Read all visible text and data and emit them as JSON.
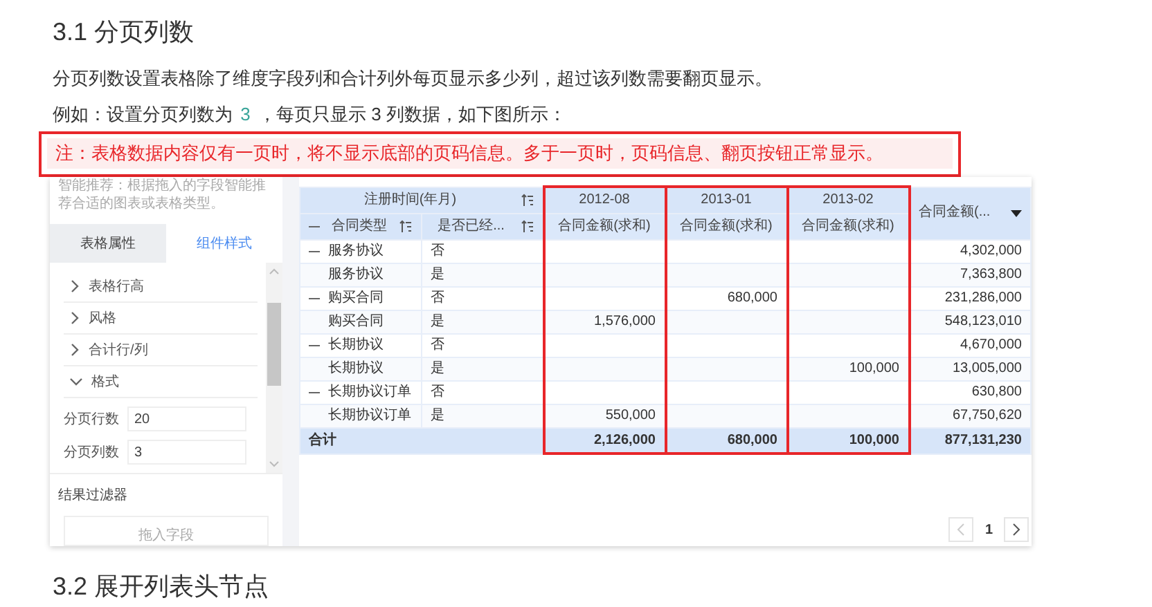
{
  "heading": "3.1 分页列数",
  "intro": "分页列数设置表格除了维度字段列和合计列外每页显示多少列，超过该列数需要翻页显示。",
  "example": [
    {
      "kind": "text",
      "text": "例如：设置分页列数为 "
    },
    {
      "kind": "code",
      "text": "3"
    },
    {
      "kind": "text",
      "text": " ，每页只显示 3 列数据，如下图所示："
    }
  ],
  "note": "注：表格数据内容仅有一页时，将不显示底部的页码信息。多于一页时，页码信息、翻页按钮正常显示。",
  "screenshot": {
    "sidebar": {
      "hint": "智能推荐：根据拖入的字段智能推荐合适的图表或表格类型。",
      "tabs": [
        {
          "label": "表格属性",
          "selected": false
        },
        {
          "label": "组件样式",
          "selected": true
        }
      ],
      "sections": [
        {
          "label": "表格行高",
          "expanded": false
        },
        {
          "label": "风格",
          "expanded": false
        },
        {
          "label": "合计行/列",
          "expanded": false
        },
        {
          "label": "格式",
          "expanded": true
        }
      ],
      "fields": [
        {
          "label": "分页行数",
          "value": "20"
        },
        {
          "label": "分页列数",
          "value": "3"
        }
      ],
      "filter_title": "结果过滤器",
      "drop_placeholder": "拖入字段"
    },
    "table": {
      "group_header": "注册时间(年月)",
      "dimension_columns": [
        "合同类型",
        "是否已经..."
      ],
      "period_columns": [
        {
          "period": "2012-08",
          "measure": "合同金额(求和)",
          "highlighted": true
        },
        {
          "period": "2013-01",
          "measure": "合同金额(求和)",
          "highlighted": true
        },
        {
          "period": "2013-02",
          "measure": "合同金额(求和)",
          "highlighted": true
        }
      ],
      "total_column": "合同金额(...",
      "rows": [
        {
          "type": "服务协议",
          "flag": "否",
          "collapsible": true,
          "total": "4,302,000"
        },
        {
          "type": "服务协议",
          "flag": "是",
          "collapsible": false,
          "total": "7,363,800"
        },
        {
          "type": "购买合同",
          "flag": "否",
          "collapsible": true,
          "period_2": "680,000",
          "total": "231,286,000"
        },
        {
          "type": "购买合同",
          "flag": "是",
          "collapsible": false,
          "period_1": "1,576,000",
          "total": "548,123,010"
        },
        {
          "type": "长期协议",
          "flag": "否",
          "collapsible": true,
          "total": "4,670,000"
        },
        {
          "type": "长期协议",
          "flag": "是",
          "collapsible": false,
          "period_3": "100,000",
          "total": "13,005,000"
        },
        {
          "type": "长期协议订单",
          "flag": "否",
          "collapsible": true,
          "total": "630,800"
        },
        {
          "type": "长期协议订单",
          "flag": "是",
          "collapsible": false,
          "period_1": "550,000",
          "total": "67,750,620"
        }
      ],
      "sum_row": {
        "label": "合计",
        "values": [
          "2,126,000",
          "680,000",
          "100,000"
        ],
        "total": "877,131,230"
      }
    },
    "pagination": {
      "page": "1"
    }
  },
  "next_heading": "3.2 展开列表头节点"
}
